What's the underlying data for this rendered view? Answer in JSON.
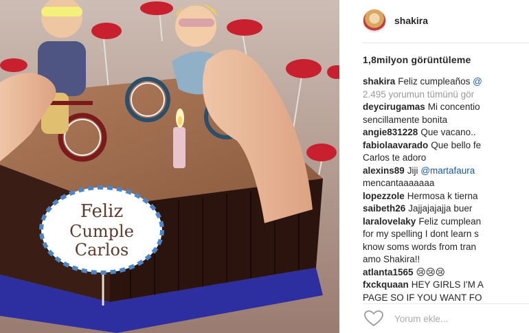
{
  "post": {
    "username": "shakira",
    "views": "1,8milyon görüntüleme",
    "caption_user": "shakira",
    "caption_text": "Feliz cumpleaños",
    "caption_mention": "@",
    "view_all": "2.495 yorumun tümünü gör",
    "add_comment_placeholder": "Yorum ekle..."
  },
  "cake_topper": {
    "line1": "Feliz",
    "line2": "Cumple",
    "line3": "Carlos"
  },
  "comments": [
    {
      "user": "deycirugamas",
      "text": "Mi concentio",
      "line2": "sencillamente bonita"
    },
    {
      "user": "angie831228",
      "text": "Que vacano.."
    },
    {
      "user": "fabiolaavarado",
      "text": "Que bello fe",
      "line2": "Carlos te adoro"
    },
    {
      "user": "alexins89",
      "text": "Jiji",
      "mention": "@martafaura",
      "line2": "mencantaaaaaaa"
    },
    {
      "user": "lopezzole",
      "text": "Hermosa k tierna"
    },
    {
      "user": "saibeth26",
      "text": "Jajjajajajja buer"
    },
    {
      "user": "laralovelaky",
      "text": "Feliz cumplean",
      "line2": "for my spelling I dont learn s",
      "line3": "know soms words from tran",
      "line4": "amo Shakira!!"
    },
    {
      "user": "atlanta1565",
      "text": "😢😢😢"
    },
    {
      "user": "fxckquaan",
      "text": "HEY GIRLS I'M A",
      "line2": "PAGE SO IF YOU WANT FO"
    }
  ],
  "colors": {
    "accent_link": "#1a5a9a",
    "muted_text": "#999999",
    "cake_brown": "#8c5a3e",
    "plate_blue": "#2d2fa0"
  },
  "icons": {
    "like": "heart-outline-icon"
  }
}
